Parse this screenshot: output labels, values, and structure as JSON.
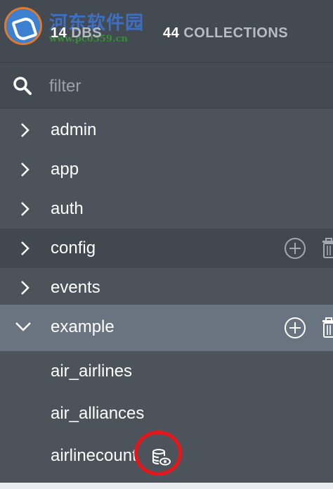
{
  "watermark": {
    "text_cn": "河东软件园",
    "url": "www.pc0359.cn"
  },
  "header": {
    "dbs": {
      "count": "14",
      "label": "DBS"
    },
    "collections": {
      "count": "44",
      "label": "COLLECTIONS"
    }
  },
  "filter": {
    "placeholder": "filter"
  },
  "databases": [
    {
      "name": "admin",
      "expanded": false
    },
    {
      "name": "app",
      "expanded": false
    },
    {
      "name": "auth",
      "expanded": false
    },
    {
      "name": "config",
      "expanded": false
    },
    {
      "name": "events",
      "expanded": false
    },
    {
      "name": "example",
      "expanded": true,
      "collections": [
        {
          "name": "air_airlines"
        },
        {
          "name": "air_alliances"
        },
        {
          "name": "airlinecount",
          "icon": "readonly-view-icon"
        }
      ]
    }
  ],
  "colors": {
    "sidebar_bg": "#4c535a",
    "selected_row": "#6a7480",
    "annotation_circle": "#e8161b"
  }
}
